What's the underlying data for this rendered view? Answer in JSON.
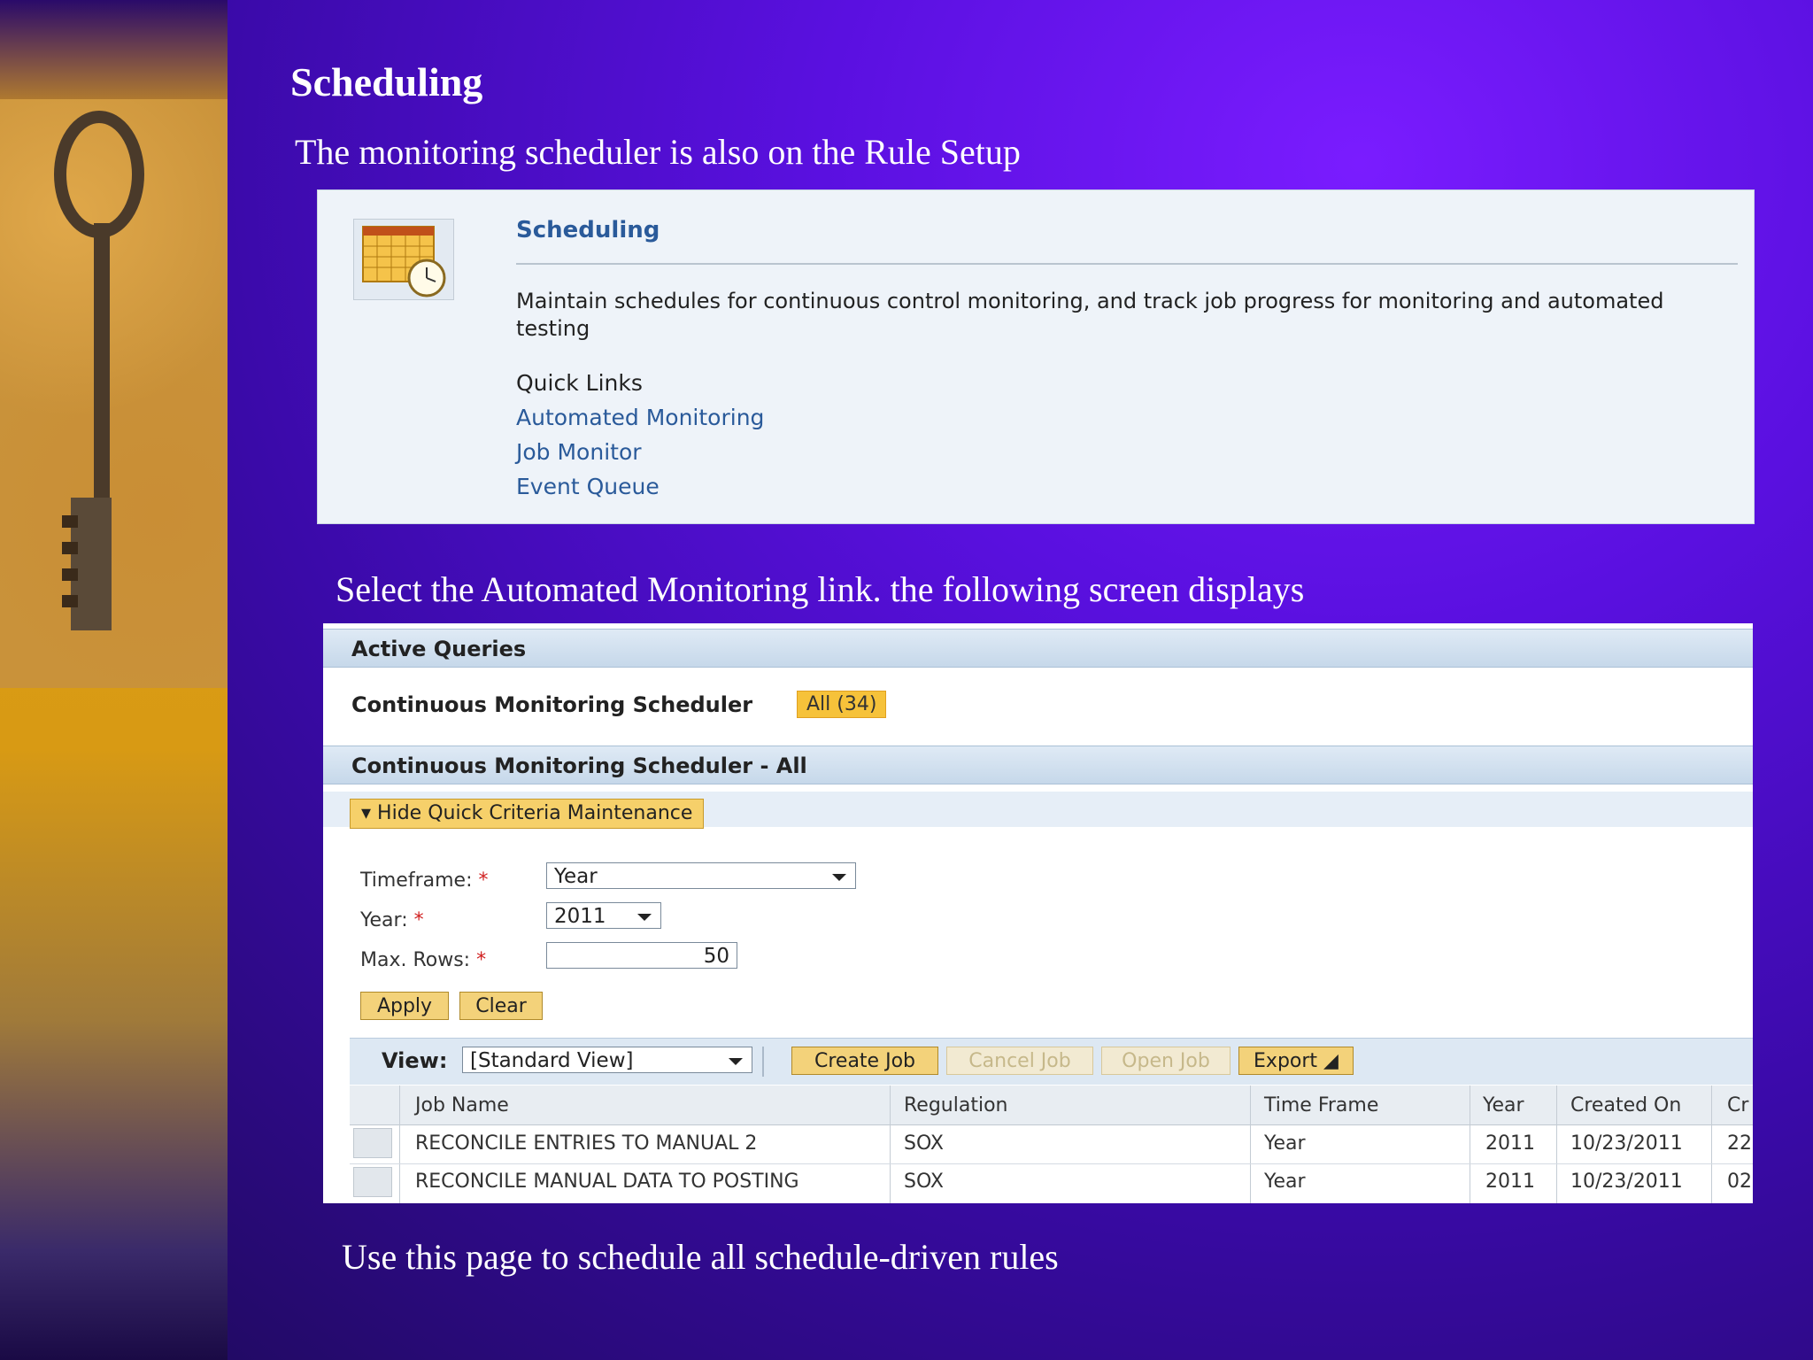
{
  "slide": {
    "title": "Scheduling",
    "intro": "The monitoring scheduler is also on the Rule Setup",
    "instruction": "Select the Automated Monitoring link. the following screen displays",
    "footer": "Use this page to schedule all schedule-driven rules"
  },
  "scheduling_panel": {
    "title": "Scheduling",
    "description": "Maintain schedules for continuous control monitoring, and track job progress for monitoring and automated testing",
    "quick_links_heading": "Quick Links",
    "links": [
      "Automated Monitoring",
      "Job Monitor",
      "Event Queue"
    ]
  },
  "monitoring_screen": {
    "active_queries_heading": "Active Queries",
    "query_name": "Continuous Monitoring Scheduler",
    "query_badge": "All (34)",
    "section_heading": "Continuous Monitoring Scheduler - All",
    "hide_criteria_label": "Hide Quick Criteria Maintenance",
    "criteria": {
      "timeframe_label": "Timeframe:",
      "timeframe_value": "Year",
      "year_label": "Year:",
      "year_value": "2011",
      "max_rows_label": "Max. Rows:",
      "max_rows_value": "50",
      "required_mark": "*"
    },
    "apply_label": "Apply",
    "clear_label": "Clear",
    "view_label": "View:",
    "view_value": "[Standard View]",
    "toolbar_buttons": [
      "Create Job",
      "Cancel Job",
      "Open Job",
      "Export"
    ],
    "table": {
      "columns": [
        "Job Name",
        "Regulation",
        "Time Frame",
        "Year",
        "Created On",
        "Cr"
      ],
      "rows": [
        [
          "RECONCILE ENTRIES TO MANUAL 2",
          "SOX",
          "Year",
          "2011",
          "10/23/2011",
          "22"
        ],
        [
          "RECONCILE MANUAL DATA TO POSTING",
          "SOX",
          "Year",
          "2011",
          "10/23/2011",
          "02"
        ]
      ]
    }
  }
}
